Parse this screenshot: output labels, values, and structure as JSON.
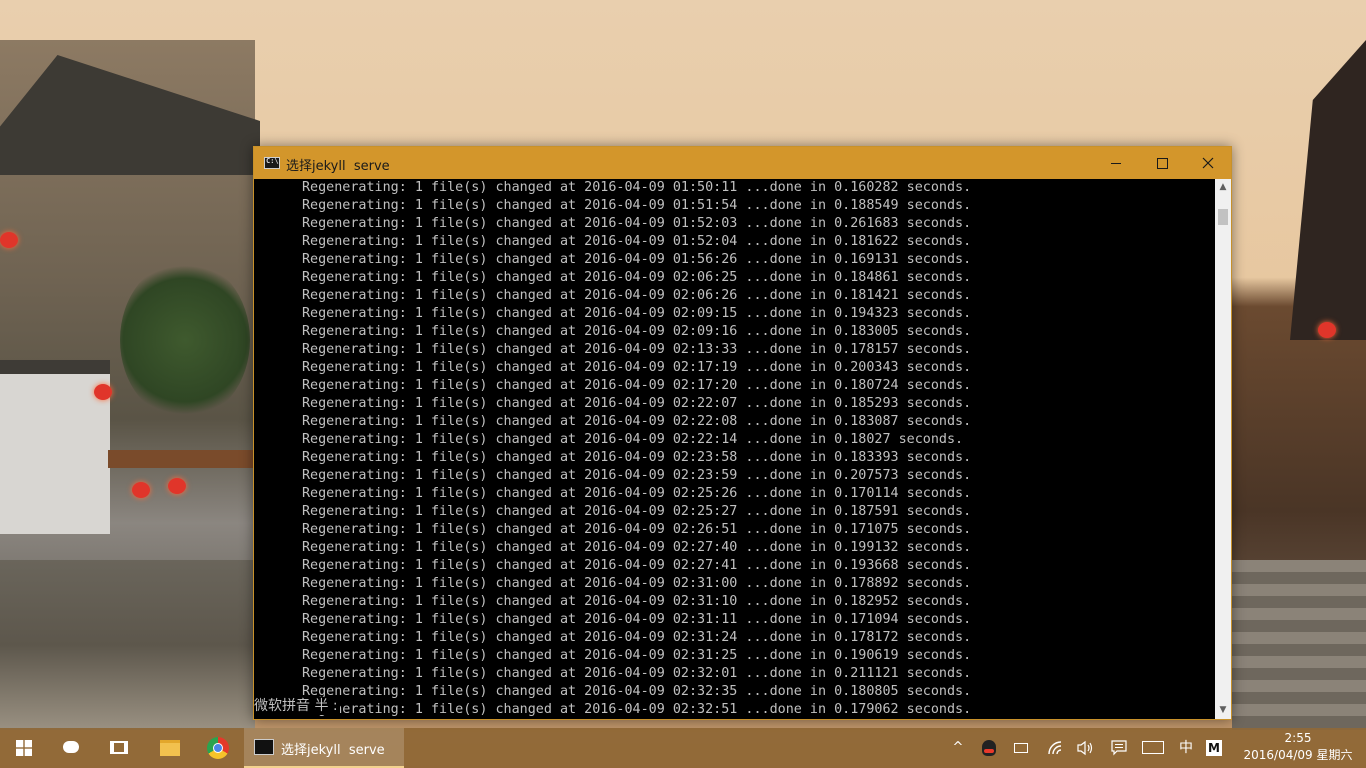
{
  "window": {
    "title": "选择jekyll  serve"
  },
  "console": {
    "lines": [
      "Regenerating: 1 file(s) changed at 2016-04-09 01:50:11 ...done in 0.160282 seconds.",
      "Regenerating: 1 file(s) changed at 2016-04-09 01:51:54 ...done in 0.188549 seconds.",
      "Regenerating: 1 file(s) changed at 2016-04-09 01:52:03 ...done in 0.261683 seconds.",
      "Regenerating: 1 file(s) changed at 2016-04-09 01:52:04 ...done in 0.181622 seconds.",
      "Regenerating: 1 file(s) changed at 2016-04-09 01:56:26 ...done in 0.169131 seconds.",
      "Regenerating: 1 file(s) changed at 2016-04-09 02:06:25 ...done in 0.184861 seconds.",
      "Regenerating: 1 file(s) changed at 2016-04-09 02:06:26 ...done in 0.181421 seconds.",
      "Regenerating: 1 file(s) changed at 2016-04-09 02:09:15 ...done in 0.194323 seconds.",
      "Regenerating: 1 file(s) changed at 2016-04-09 02:09:16 ...done in 0.183005 seconds.",
      "Regenerating: 1 file(s) changed at 2016-04-09 02:13:33 ...done in 0.178157 seconds.",
      "Regenerating: 1 file(s) changed at 2016-04-09 02:17:19 ...done in 0.200343 seconds.",
      "Regenerating: 1 file(s) changed at 2016-04-09 02:17:20 ...done in 0.180724 seconds.",
      "Regenerating: 1 file(s) changed at 2016-04-09 02:22:07 ...done in 0.185293 seconds.",
      "Regenerating: 1 file(s) changed at 2016-04-09 02:22:08 ...done in 0.183087 seconds.",
      "Regenerating: 1 file(s) changed at 2016-04-09 02:22:14 ...done in 0.18027 seconds.",
      "Regenerating: 1 file(s) changed at 2016-04-09 02:23:58 ...done in 0.183393 seconds.",
      "Regenerating: 1 file(s) changed at 2016-04-09 02:23:59 ...done in 0.207573 seconds.",
      "Regenerating: 1 file(s) changed at 2016-04-09 02:25:26 ...done in 0.170114 seconds.",
      "Regenerating: 1 file(s) changed at 2016-04-09 02:25:27 ...done in 0.187591 seconds.",
      "Regenerating: 1 file(s) changed at 2016-04-09 02:26:51 ...done in 0.171075 seconds.",
      "Regenerating: 1 file(s) changed at 2016-04-09 02:27:40 ...done in 0.199132 seconds.",
      "Regenerating: 1 file(s) changed at 2016-04-09 02:27:41 ...done in 0.193668 seconds.",
      "Regenerating: 1 file(s) changed at 2016-04-09 02:31:00 ...done in 0.178892 seconds.",
      "Regenerating: 1 file(s) changed at 2016-04-09 02:31:10 ...done in 0.182952 seconds.",
      "Regenerating: 1 file(s) changed at 2016-04-09 02:31:11 ...done in 0.171094 seconds.",
      "Regenerating: 1 file(s) changed at 2016-04-09 02:31:24 ...done in 0.178172 seconds.",
      "Regenerating: 1 file(s) changed at 2016-04-09 02:31:25 ...done in 0.190619 seconds.",
      "Regenerating: 1 file(s) changed at 2016-04-09 02:32:01 ...done in 0.211121 seconds.",
      "Regenerating: 1 file(s) changed at 2016-04-09 02:32:35 ...done in 0.180805 seconds.",
      "Regenerating: 1 file(s) changed at 2016-04-09 02:32:51 ...done in 0.179062 seconds."
    ],
    "ime_indicator": "微软拼音 半 :"
  },
  "taskbar": {
    "apps": [
      {
        "name": "start",
        "icon": "windows-logo-icon"
      },
      {
        "name": "cortana",
        "icon": "cortana-icon"
      },
      {
        "name": "task-view",
        "icon": "task-view-icon"
      },
      {
        "name": "file-explorer",
        "icon": "folder-icon"
      },
      {
        "name": "chrome",
        "icon": "chrome-icon"
      }
    ],
    "active_window_label": "选择jekyll  serve",
    "tray": {
      "chevron": "^",
      "language": "中",
      "ime_mode": "M",
      "time": "2:55",
      "date": "2016/04/09 星期六"
    }
  },
  "colors": {
    "titlebar": "#d3962b",
    "console_bg": "#000000",
    "console_text": "#c0c0c0"
  }
}
